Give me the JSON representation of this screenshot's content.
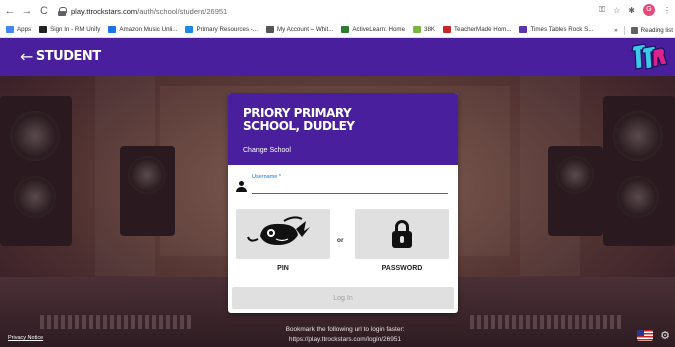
{
  "browser": {
    "url_host": "play.ttrockstars.com",
    "url_path": "/auth/school/student/26951",
    "avatar_letter": "G"
  },
  "bookmarks": {
    "items": [
      {
        "label": "Apps",
        "color": "#4285f4"
      },
      {
        "label": "Sign In - RM Unify",
        "color": "#222222"
      },
      {
        "label": "Amazon Music Unli...",
        "color": "#1a73e8"
      },
      {
        "label": "Primary Resources -...",
        "color": "#1e88e5"
      },
      {
        "label": "My Account – Whit...",
        "color": "#555555"
      },
      {
        "label": "ActiveLearn: Home",
        "color": "#2e7d32"
      },
      {
        "label": "38K",
        "color": "#7cb342"
      },
      {
        "label": "TeacherMade Hom...",
        "color": "#c62828"
      },
      {
        "label": "Times Tables Rock S...",
        "color": "#5e35b1"
      }
    ],
    "overflow": "»",
    "reading_list": "Reading list"
  },
  "header": {
    "back_label": "STUDENT",
    "logo_text": "TTRS",
    "bg_color": "#4a1f9e"
  },
  "card": {
    "school_name": "PRIORY PRIMARY SCHOOL, DUDLEY",
    "change_school": "Change School",
    "username_label": "Username *",
    "username_value": "",
    "pin_label": "PIN",
    "or_label": "or",
    "password_label": "PASSWORD",
    "login_label": "Log In"
  },
  "footer": {
    "privacy": "Privacy Notice",
    "bookmark_tip_line1": "Bookmark the following url to login faster:",
    "bookmark_tip_line2": "https://play.ttrockstars.com/login/26951"
  }
}
